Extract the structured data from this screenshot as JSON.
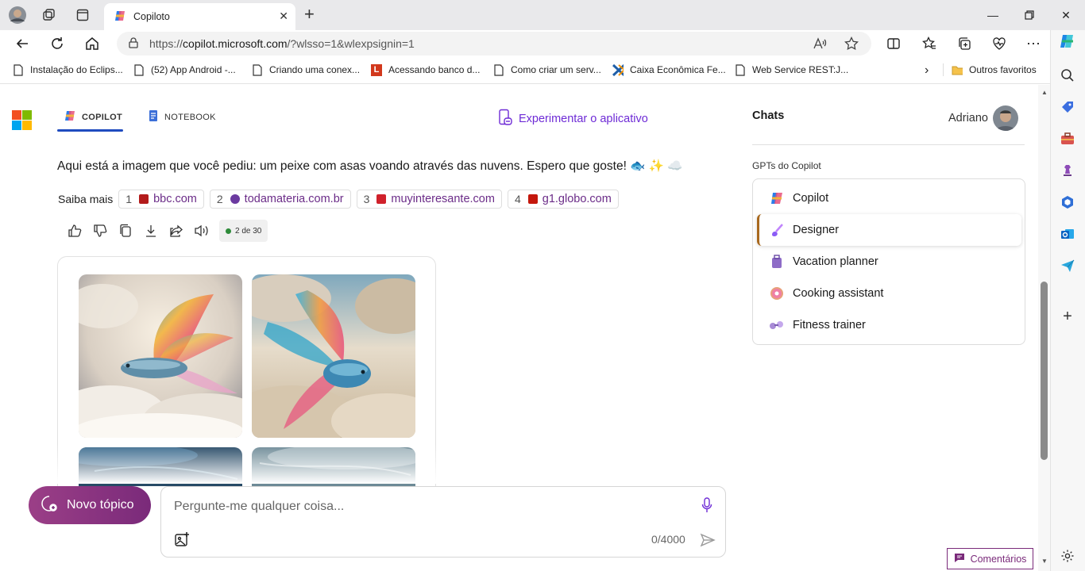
{
  "browser": {
    "tab_title": "Copiloto",
    "url_prefix": "https://",
    "url_host": "copilot.microsoft.com",
    "url_path": "/?wlsso=1&wlexpsignin=1",
    "bookmarks": [
      {
        "label": "Instalação do Eclips...",
        "icon": "page-icon"
      },
      {
        "label": "(52) App Android -...",
        "icon": "page-icon"
      },
      {
        "label": "Criando uma conex...",
        "icon": "page-icon"
      },
      {
        "label": "Acessando banco d...",
        "icon": "l-logo-icon"
      },
      {
        "label": "Como criar um serv...",
        "icon": "page-icon"
      },
      {
        "label": "Caixa Econômica Fe...",
        "icon": "caixa-logo-icon"
      },
      {
        "label": "Web Service REST:J...",
        "icon": "page-icon"
      }
    ],
    "other_favorites": "Outros favoritos",
    "feedback": "Comentários"
  },
  "header": {
    "tab_copilot": "COPILOT",
    "tab_notebook": "NOTEBOOK",
    "try_app": "Experimentar o aplicativo"
  },
  "conversation": {
    "message": "Aqui está a imagem que você pediu: um peixe com asas voando através das nuvens. Espero que goste! 🐟 ✨ ☁️",
    "learn_more_label": "Saiba mais",
    "sources": [
      {
        "num": "1",
        "label": "bbc.com",
        "color": "#b31b1b"
      },
      {
        "num": "2",
        "label": "todamateria.com.br",
        "color": "#6b3aa0"
      },
      {
        "num": "3",
        "label": "muyinteresante.com",
        "color": "#d0212b"
      },
      {
        "num": "4",
        "label": "g1.globo.com",
        "color": "#c4170c"
      }
    ],
    "turn_counter": "2 de 30"
  },
  "composer": {
    "new_topic": "Novo tópico",
    "placeholder": "Pergunte-me qualquer coisa...",
    "char_count": "0/4000"
  },
  "sidebar": {
    "chats_title": "Chats",
    "user_name": "Adriano",
    "gpts_label": "GPTs do Copilot",
    "gpts": [
      {
        "label": "Copilot",
        "icon": "copilot-icon"
      },
      {
        "label": "Designer",
        "icon": "designer-icon",
        "selected": true
      },
      {
        "label": "Vacation planner",
        "icon": "suitcase-icon"
      },
      {
        "label": "Cooking assistant",
        "icon": "donut-icon"
      },
      {
        "label": "Fitness trainer",
        "icon": "dumbbell-icon"
      }
    ]
  },
  "colors": {
    "accent": "#7a2a7a",
    "link_purple": "#6e2bd6"
  }
}
